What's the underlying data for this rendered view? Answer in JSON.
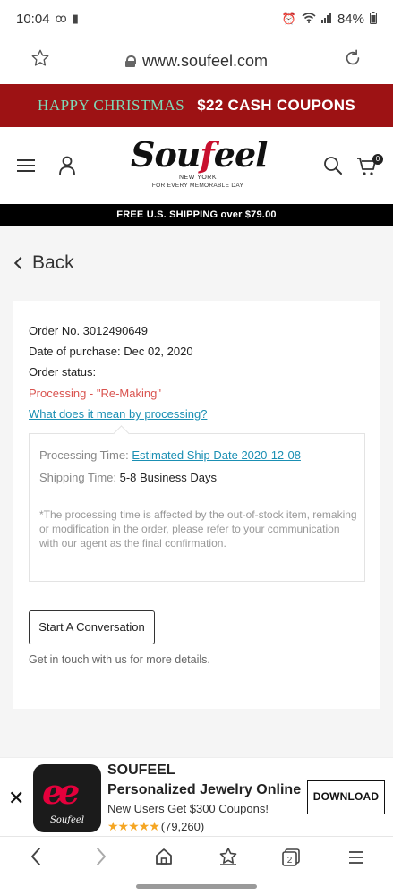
{
  "status_bar": {
    "time": "10:04",
    "battery": "84%"
  },
  "browser": {
    "url": "www.soufeel.com"
  },
  "promo_banner": {
    "greeting": "HAPPY CHRISTMAS",
    "offer": "$22 CASH COUPONS"
  },
  "site_header": {
    "logo_text": "Soufeel",
    "logo_city": "NEW YORK",
    "logo_tagline": "FOR EVERY MEMORABLE DAY",
    "cart_count": "0"
  },
  "shipping_bar": {
    "text": "FREE U.S. SHIPPING over $79.00"
  },
  "page": {
    "back_label": "Back",
    "order_no": "Order No. 3012490649",
    "purchase_date": "Date of purchase: Dec 02, 2020",
    "status_label": "Order status:",
    "status_value": "Processing - \"Re-Making\"",
    "processing_link": "What does it mean by processing?",
    "processing_time_label": "Processing Time: ",
    "processing_time_value": "Estimated Ship Date 2020-12-08",
    "shipping_time_label": "Shipping Time: ",
    "shipping_time_value": "5-8 Business Days",
    "note": "*The processing time is affected by the out-of-stock item, remaking or modification in the order, please refer to your communication with our agent as the final confirmation.",
    "conversation_button": "Start A Conversation",
    "touch_text": "Get in touch with us for more details."
  },
  "ad": {
    "logo_sub": "Soufeel",
    "brand": "SOUFEEL",
    "headline": "Personalized Jewelry Online",
    "subline": "New Users Get $300 Coupons!",
    "stars": "★★★★★",
    "rating_count": "(79,260)",
    "button": "DOWNLOAD"
  },
  "nav": {
    "tabs_count": "2"
  },
  "colors": {
    "banner_red": "#9d1214",
    "banner_green": "#7ed9b8",
    "status_red": "#d9534f",
    "link_blue": "#1a8fb3"
  }
}
